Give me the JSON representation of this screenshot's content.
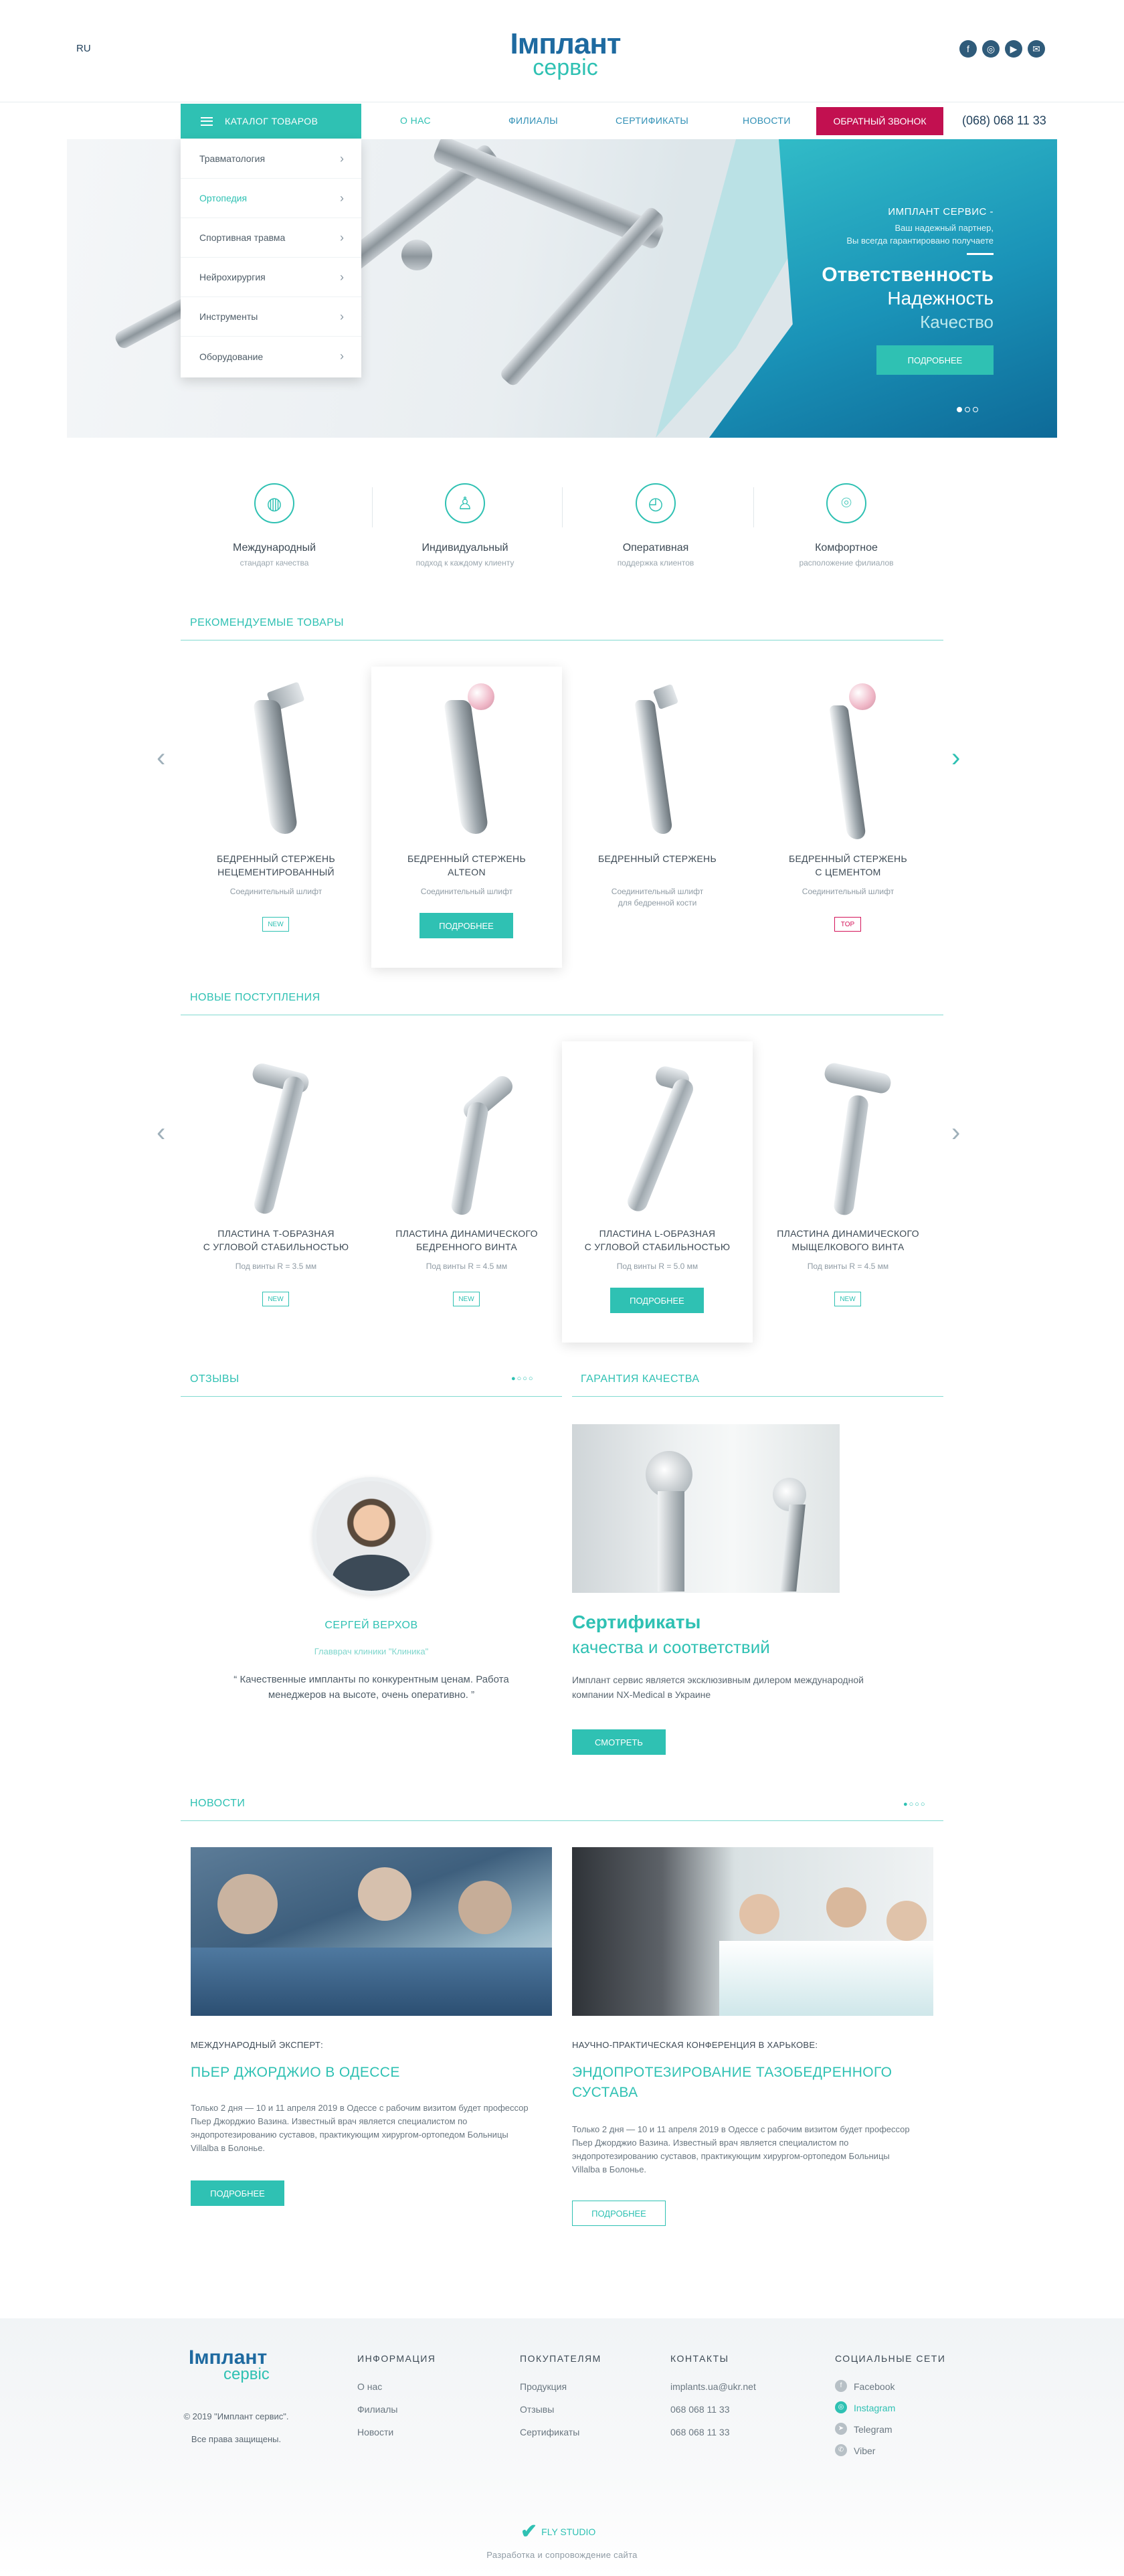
{
  "header": {
    "lang": "RU",
    "logo_line1": "Імплант",
    "logo_line2": "сервіс",
    "social": [
      "facebook-icon",
      "instagram-icon",
      "youtube-icon",
      "email-icon"
    ]
  },
  "nav": {
    "catalog": "КАТАЛОГ ТОВАРОВ",
    "items": [
      "О НАС",
      "ФИЛИАЛЫ",
      "СЕРТИФИКАТЫ",
      "НОВОСТИ"
    ],
    "callback": "ОБРАТНЫЙ ЗВОНОК",
    "phone": "(068) 068 11 33"
  },
  "catalog_menu": [
    "Травматология",
    "Ортопедия",
    "Спортивная травма",
    "Нейрохирургия",
    "Инструменты",
    "Оборудование"
  ],
  "hero": {
    "kicker": "ИМПЛАНТ СЕРВИС -",
    "sub1": "Ваш надежный партнер,",
    "sub2": "Вы всегда гарантировано получаете",
    "h1": "Ответственность",
    "h2": "Надежность",
    "h3": "Качество",
    "button": "ПОДРОБНЕЕ"
  },
  "features": [
    {
      "title": "Международный",
      "sub": "стандарт качества",
      "icon": "globe-icon"
    },
    {
      "title": "Индивидуальный",
      "sub": "подход к каждому клиенту",
      "icon": "user-icon"
    },
    {
      "title": "Оперативная",
      "sub": "поддержка клиентов",
      "icon": "clock-icon"
    },
    {
      "title": "Комфортное",
      "sub": "расположение филиалов",
      "icon": "location-pin-icon"
    }
  ],
  "recommended": {
    "title": "РЕКОМЕНДУЕМЫЕ ТОВАРЫ",
    "items": [
      {
        "name1": "БЕДРЕННЫЙ СТЕРЖЕНЬ",
        "name2": "НЕЦЕМЕНТИРОВАННЫЙ",
        "sub1": "Соединительный шлифт",
        "sub2": "",
        "badge": "NEW"
      },
      {
        "name1": "БЕДРЕННЫЙ СТЕРЖЕНЬ",
        "name2": "ALTEON",
        "sub1": "Соединительный шлифт",
        "sub2": "",
        "badge": ""
      },
      {
        "name1": "БЕДРЕННЫЙ СТЕРЖЕНЬ",
        "name2": "",
        "sub1": "Соединительный шлифт",
        "sub2": "для бедренной кости",
        "badge": ""
      },
      {
        "name1": "БЕДРЕННЫЙ СТЕРЖЕНЬ",
        "name2": "С ЦЕМЕНТОМ",
        "sub1": "Соединительный шлифт",
        "sub2": "",
        "badge": "TOP"
      }
    ],
    "button": "ПОДРОБНЕЕ"
  },
  "arrivals": {
    "title": "НОВЫЕ ПОСТУПЛЕНИЯ",
    "items": [
      {
        "name1": "ПЛАСТИНА Т-ОБРАЗНАЯ",
        "name2": "С УГЛОВОЙ СТАБИЛЬНОСТЬЮ",
        "sub1": "Под винты R = 3.5 мм",
        "badge": "NEW"
      },
      {
        "name1": "ПЛАСТИНА ДИНАМИЧЕСКОГО",
        "name2": "БЕДРЕННОГО ВИНТА",
        "sub1": "Под винты R = 4.5 мм",
        "badge": "NEW"
      },
      {
        "name1": "ПЛАСТИНА L-ОБРАЗНАЯ",
        "name2": "С УГЛОВОЙ СТАБИЛЬНОСТЬЮ",
        "sub1": "Под винты R = 5.0 мм",
        "badge": ""
      },
      {
        "name1": "ПЛАСТИНА ДИНАМИЧЕСКОГО",
        "name2": "МЫЩЕЛКОВОГО ВИНТА",
        "sub1": "Под винты R = 4.5 мм",
        "badge": "NEW"
      }
    ],
    "button": "ПОДРОБНЕЕ"
  },
  "reviews": {
    "title": "ОТЗЫВЫ",
    "name": "СЕРГЕЙ ВЕРХОВ",
    "role": "Главврач клиники \"Клиника\"",
    "quote": "Качественные импланты по конкурентным ценам. Работа менеджеров на высоте, очень оперативно."
  },
  "guarantee": {
    "title": "ГАРАНТИЯ КАЧЕСТВА",
    "h1": "Сертификаты",
    "h2": "качества и соответствий",
    "text": "Имплант сервис является эксклюзивным дилером международной компании NX-Medical в Украине",
    "button": "СМОТРЕТЬ"
  },
  "news": {
    "title": "НОВОСТИ",
    "items": [
      {
        "kicker": "МЕЖДУНАРОДНЫЙ ЭКСПЕРТ:",
        "title": "ПЬЕР ДЖОРДЖИО В ОДЕССЕ",
        "text": "Только 2 дня — 10 и 11 апреля 2019 в Одессе с рабочим визитом будет профессор Пьер Джорджио Вазина. Известный врач является специалистом по эндопротезированию суставов, практикующим хирургом-ортопедом Больницы Villalba в Болонье.",
        "button": "ПОДРОБНЕЕ"
      },
      {
        "kicker": "НАУЧНО-ПРАКТИЧЕСКАЯ КОНФЕРЕНЦИЯ В ХАРЬКОВЕ:",
        "title": "ЭНДОПРОТЕЗИРОВАНИЕ ТАЗОБЕДРЕННОГО СУСТАВА",
        "text": "Только 2 дня — 10 и 11 апреля 2019 в Одессе с рабочим визитом будет профессор Пьер Джорджио Вазина. Известный врач является специалистом по эндопротезированию суставов, практикующим хирургом-ортопедом Больницы Villalba в Болонье.",
        "button": "ПОДРОБНЕЕ"
      }
    ]
  },
  "footer": {
    "logo_line1": "Імплант",
    "logo_line2": "сервіс",
    "copy1": "© 2019 \"Имплант сервис\".",
    "copy2": "Все права защищены.",
    "info_head": "ИНФОРМАЦИЯ",
    "info": [
      "О нас",
      "Филиалы",
      "Новости"
    ],
    "buyers_head": "ПОКУПАТЕЛЯМ",
    "buyers": [
      "Продукция",
      "Отзывы",
      "Сертификаты"
    ],
    "contacts_head": "КОНТАКТЫ",
    "contacts": [
      "implants.ua@ukr.net",
      "068 068 11 33",
      "068 068 11 33"
    ],
    "social_head": "СОЦИАЛЬНЫЕ СЕТИ",
    "social": [
      "Facebook",
      "Instagram",
      "Telegram",
      "Viber"
    ],
    "studio": "FLY STUDIO",
    "studio_sub": "Разработка и сопровождение сайта"
  },
  "colors": {
    "accent": "#2fc1b3",
    "brand_blue": "#1e6aa0",
    "callback": "#c21050"
  }
}
